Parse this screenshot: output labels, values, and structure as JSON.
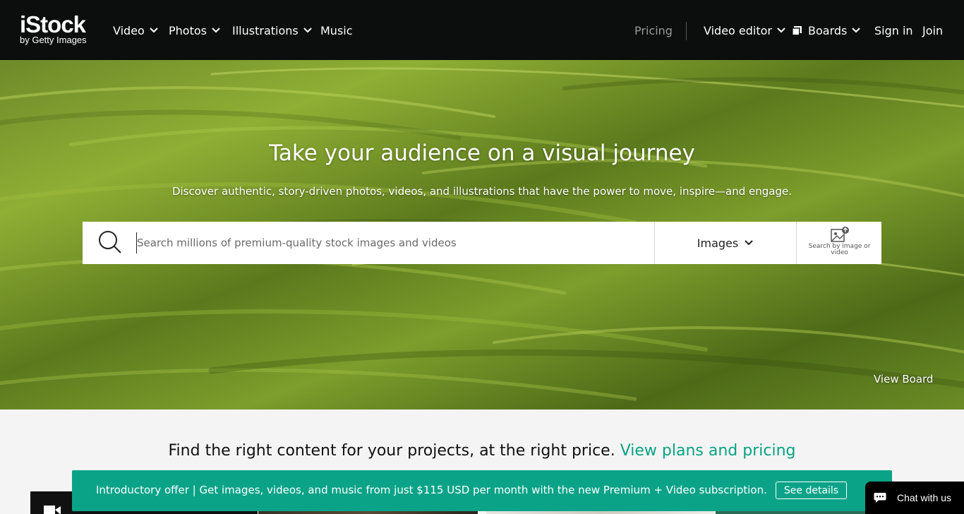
{
  "nav": {
    "logo_main": "iStock",
    "logo_sub": "by Getty Images",
    "left_items": [
      {
        "label": "Video",
        "has_dropdown": true
      },
      {
        "label": "Photos",
        "has_dropdown": true
      },
      {
        "label": "Illustrations",
        "has_dropdown": true
      },
      {
        "label": "Music",
        "has_dropdown": false
      }
    ],
    "pricing": "Pricing",
    "video_editor": "Video editor",
    "boards": "Boards",
    "sign_in": "Sign in",
    "join": "Join"
  },
  "hero": {
    "title": "Take your audience on a visual journey",
    "subtitle": "Discover authentic, story-driven photos, videos, and illustrations that have the power to move, inspire—and engage.",
    "search_placeholder": "Search millions of premium-quality stock images and videos",
    "search_value": "",
    "media_type": "Images",
    "visual_search_label": "Search by image or video",
    "view_board": "View Board"
  },
  "promo": {
    "text": "Find the right content for your projects, at the right price.",
    "link": "View plans and pricing"
  },
  "offer": {
    "text": "Introductory offer | Get images, videos, and music from just $115 USD per month with the new Premium + Video subscription.",
    "button": "See details"
  },
  "chat": {
    "label": "Chat with us"
  },
  "colors": {
    "nav_bg": "#0c0d0d",
    "accent": "#0aa388",
    "link": "#08a284"
  },
  "icons": [
    "chevron-down-icon",
    "boards-icon",
    "search-icon",
    "visual-search-icon",
    "video-camera-icon",
    "chat-bubble-icon"
  ]
}
